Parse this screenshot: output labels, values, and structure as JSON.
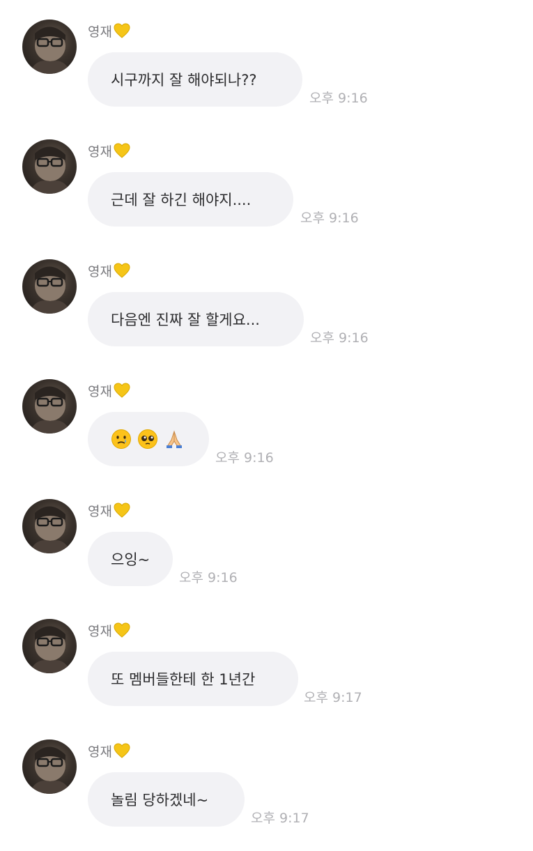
{
  "messages": [
    {
      "sender": "영재",
      "text": "시구까지 잘 해야되나??",
      "time": "오후 9:16"
    },
    {
      "sender": "영재",
      "text": "근데 잘 하긴 해야지....",
      "time": "오후 9:16"
    },
    {
      "sender": "영재",
      "text": "다음엔 진짜 잘 할게요...",
      "time": "오후 9:16"
    },
    {
      "sender": "영재",
      "emojis": [
        "crying-face",
        "pleading-face",
        "folded-hands"
      ],
      "time": "오후 9:16"
    },
    {
      "sender": "영재",
      "text": "으잉~",
      "time": "오후 9:16"
    },
    {
      "sender": "영재",
      "text": "또 멤버들한테 한 1년간",
      "time": "오후 9:17"
    },
    {
      "sender": "영재",
      "text": "놀림 당하겠네~",
      "time": "오후 9:17"
    }
  ],
  "colors": {
    "bubble_bg": "#f2f2f5",
    "sender_text": "#7b7b7f",
    "time_text": "#b0b0b4",
    "heart": "#f5c518"
  }
}
